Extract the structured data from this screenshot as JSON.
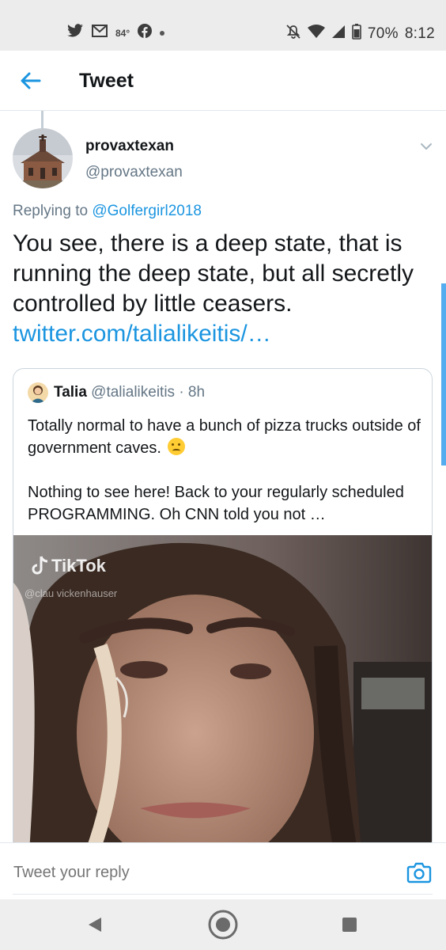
{
  "status_bar": {
    "temperature": "84°",
    "battery": "70%",
    "time": "8:12",
    "icons": [
      "twitter-icon",
      "gmail-icon",
      "facebook-icon",
      "dot-icon",
      "mute-icon",
      "wifi-icon",
      "signal-icon",
      "battery-icon"
    ]
  },
  "app_bar": {
    "title": "Tweet",
    "back_icon": "arrow-left-icon",
    "accent_color": "#1b95e0"
  },
  "tweet": {
    "display_name": "provaxtexan",
    "handle": "@provaxtexan",
    "replying_prefix": "Replying to",
    "replying_to": "@Golfergirl2018",
    "text": "You see, there is a deep state, that is running the deep state, but all secretly controlled by little ceasers.",
    "link": "twitter.com/talialikeitis/…"
  },
  "quoted_tweet": {
    "name": "Talia",
    "handle": "@talialikeitis",
    "time": "· 8h",
    "paragraph1": "Totally normal to have a bunch of pizza trucks outside of government caves.",
    "paragraph2": "Nothing to see here! Back to your regularly scheduled PROGRAMMING. Oh CNN told you not …",
    "media": {
      "watermark": "TikTok",
      "watermark_user": "@clau  vickenhauser"
    }
  },
  "reply_bar": {
    "placeholder": "Tweet your reply",
    "camera_icon": "camera-icon"
  },
  "nav_bar": {
    "icons": [
      "back-triangle-icon",
      "home-circle-icon",
      "recents-square-icon"
    ]
  }
}
